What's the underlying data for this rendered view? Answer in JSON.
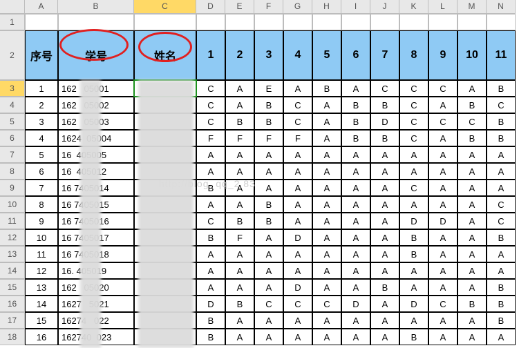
{
  "col_letters": [
    "",
    "A",
    "B",
    "C",
    "D",
    "E",
    "F",
    "G",
    "H",
    "I",
    "J",
    "K",
    "L",
    "M",
    "N"
  ],
  "row_numbers": [
    "1",
    "2",
    "3",
    "4",
    "5",
    "6",
    "7",
    "8",
    "9",
    "10",
    "11",
    "12",
    "13",
    "14",
    "15",
    "16",
    "17",
    "18"
  ],
  "header": {
    "seq": "序号",
    "id": "学号",
    "name": "姓名",
    "cols": [
      "1",
      "2",
      "3",
      "4",
      "5",
      "6",
      "7",
      "8",
      "9",
      "10",
      "11"
    ]
  },
  "rows": [
    {
      "seq": "1",
      "id": "162   05001",
      "name": "",
      "g": [
        "C",
        "A",
        "E",
        "A",
        "B",
        "A",
        "C",
        "C",
        "C",
        "A",
        "B"
      ]
    },
    {
      "seq": "2",
      "id": "162   05002",
      "name": "",
      "g": [
        "C",
        "A",
        "B",
        "C",
        "A",
        "B",
        "B",
        "C",
        "A",
        "B",
        "C"
      ]
    },
    {
      "seq": "3",
      "id": "162   05003",
      "name": "",
      "g": [
        "C",
        "B",
        "B",
        "C",
        "A",
        "B",
        "D",
        "C",
        "C",
        "C",
        "B"
      ]
    },
    {
      "seq": "4",
      "id": "1624  05004",
      "name": "",
      "g": [
        "F",
        "F",
        "F",
        "F",
        "A",
        "B",
        "B",
        "C",
        "A",
        "B",
        "B"
      ]
    },
    {
      "seq": "5",
      "id": "16  405005",
      "name": "",
      "g": [
        "A",
        "A",
        "A",
        "A",
        "A",
        "A",
        "A",
        "A",
        "A",
        "A",
        "A"
      ]
    },
    {
      "seq": "6",
      "id": "16  405012",
      "name": "",
      "g": [
        "A",
        "A",
        "A",
        "A",
        "A",
        "A",
        "A",
        "A",
        "A",
        "A",
        "A"
      ]
    },
    {
      "seq": "7",
      "id": "16 7405014",
      "name": "",
      "g": [
        "B",
        "A",
        "A",
        "A",
        "A",
        "A",
        "A",
        "C",
        "A",
        "A",
        "A"
      ]
    },
    {
      "seq": "8",
      "id": "16 7405015",
      "name": "",
      "g": [
        "A",
        "A",
        "B",
        "A",
        "A",
        "A",
        "A",
        "A",
        "A",
        "A",
        "C"
      ]
    },
    {
      "seq": "9",
      "id": "16 7405016",
      "name": "",
      "g": [
        "C",
        "B",
        "B",
        "A",
        "A",
        "A",
        "A",
        "D",
        "D",
        "A",
        "C"
      ]
    },
    {
      "seq": "10",
      "id": "16 7405017",
      "name": "",
      "g": [
        "B",
        "F",
        "A",
        "D",
        "A",
        "A",
        "A",
        "B",
        "A",
        "A",
        "B"
      ]
    },
    {
      "seq": "11",
      "id": "16 7405018",
      "name": "",
      "g": [
        "A",
        "A",
        "A",
        "A",
        "A",
        "A",
        "A",
        "B",
        "A",
        "A",
        "A"
      ]
    },
    {
      "seq": "12",
      "id": "16. 405019",
      "name": "",
      "g": [
        "A",
        "A",
        "A",
        "A",
        "A",
        "A",
        "A",
        "A",
        "A",
        "A",
        "A"
      ]
    },
    {
      "seq": "13",
      "id": "162   05020",
      "name": "",
      "g": [
        "A",
        "A",
        "A",
        "D",
        "A",
        "A",
        "B",
        "A",
        "A",
        "A",
        "B"
      ]
    },
    {
      "seq": "14",
      "id": "1627   5021",
      "name": "",
      "g": [
        "D",
        "B",
        "C",
        "C",
        "C",
        "D",
        "A",
        "D",
        "C",
        "B",
        "B"
      ]
    },
    {
      "seq": "15",
      "id": "16274   022",
      "name": "",
      "g": [
        "B",
        "A",
        "A",
        "A",
        "A",
        "A",
        "A",
        "A",
        "A",
        "A",
        "B"
      ]
    },
    {
      "seq": "16",
      "id": "162740  023",
      "name": "",
      "g": [
        "B",
        "A",
        "A",
        "A",
        "A",
        "A",
        "A",
        "B",
        "A",
        "A",
        "A"
      ]
    }
  ],
  "selected_row_idx": 0,
  "watermark": "http://blog.          qq_2  83"
}
